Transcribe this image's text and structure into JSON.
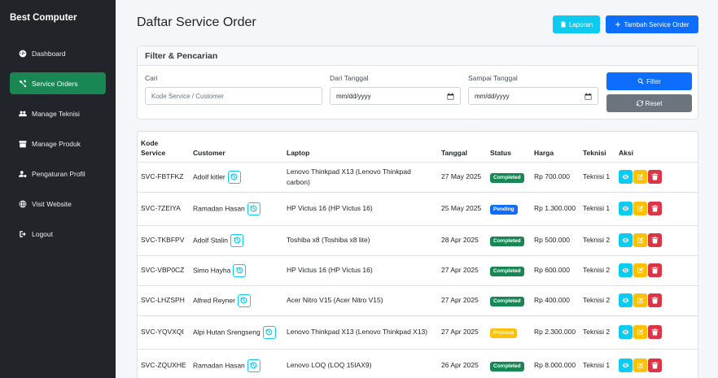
{
  "sidebar": {
    "brand": "Best Computer",
    "items": [
      {
        "label": "Dashboard",
        "icon": "gauge-icon"
      },
      {
        "label": "Service Orders",
        "icon": "tools-icon",
        "active": true
      },
      {
        "label": "Manage Teknisi",
        "icon": "users-icon"
      },
      {
        "label": "Manage Produk",
        "icon": "box-icon"
      },
      {
        "label": "Pengaturan Profil",
        "icon": "user-gear-icon"
      },
      {
        "label": "Visit Website",
        "icon": "globe-icon"
      },
      {
        "label": "Logout",
        "icon": "logout-icon"
      }
    ]
  },
  "header": {
    "title": "Daftar Service Order",
    "laporan_label": "Laporan",
    "tambah_label": "Tambah Service Order"
  },
  "filter": {
    "title": "Filter & Pencarian",
    "cari_label": "Cari",
    "cari_placeholder": "Kode Service / Customer",
    "dari_label": "Dari Tanggal",
    "dari_value": "mm/dd/yyyy",
    "sampai_label": "Sampai Tanggal",
    "sampai_value": "mm/dd/yyyy",
    "filter_label": "Filter",
    "reset_label": "Reset"
  },
  "table": {
    "headers": {
      "kode_1": "Kode",
      "kode_2": "Service",
      "customer": "Customer",
      "laptop": "Laptop",
      "tanggal": "Tanggal",
      "status": "Status",
      "harga": "Harga",
      "teknisi": "Teknisi",
      "aksi": "Aksi"
    },
    "rows": [
      {
        "kode": "SVC-FBTFKZ",
        "customer": "Adolf kitler",
        "laptop": "Lenovo Thinkpad X13 (Lenovo Thinkpad carbon)",
        "tanggal": "27 May 2025",
        "status": "Completed",
        "harga": "Rp 700.000",
        "teknisi": "Teknisi 1"
      },
      {
        "kode": "SVC-7ZEIYA",
        "customer": "Ramadan Hasan",
        "laptop": "HP Victus 16 (HP Victus 16)",
        "tanggal": "25 May 2025",
        "status": "Pending",
        "harga": "Rp 1.300.000",
        "teknisi": "Teknisi 1"
      },
      {
        "kode": "SVC-TKBFPV",
        "customer": "Adolf Stalin",
        "laptop": "Toshiba x8 (Toshiba x8 lite)",
        "tanggal": "28 Apr 2025",
        "status": "Completed",
        "harga": "Rp 500.000",
        "teknisi": "Teknisi 2"
      },
      {
        "kode": "SVC-VBP0CZ",
        "customer": "Simo Hayha",
        "laptop": "HP Victus 16 (HP Victus 16)",
        "tanggal": "27 Apr 2025",
        "status": "Completed",
        "harga": "Rp 600.000",
        "teknisi": "Teknisi 2"
      },
      {
        "kode": "SVC-LHZSPH",
        "customer": "Alfred Reyner",
        "laptop": "Acer Nitro V15 (Acer Nitro V15)",
        "tanggal": "27 Apr 2025",
        "status": "Completed",
        "harga": "Rp 400.000",
        "teknisi": "Teknisi 2"
      },
      {
        "kode": "SVC-YQVXQI",
        "customer": "Alpi Hutan Srengseng",
        "laptop": "Lenovo Thinkpad X13 (Lenovo Thinkpad X13)",
        "tanggal": "27 Apr 2025",
        "status": "Process",
        "harga": "Rp 2.300.000",
        "teknisi": "Teknisi 2"
      },
      {
        "kode": "SVC-ZQUXHE",
        "customer": "Ramadan Hasan",
        "laptop": "Lenovo LOQ (LOQ 15IAX9)",
        "tanggal": "26 Apr 2025",
        "status": "Completed",
        "harga": "Rp 8.000.000",
        "teknisi": "Teknisi 1"
      }
    ]
  },
  "colors": {
    "sidebar_bg": "#212529",
    "active_nav": "#198754",
    "primary": "#0d6efd",
    "info": "#0dcaf0",
    "warning": "#ffc107",
    "danger": "#dc3545",
    "secondary": "#6c757d"
  }
}
